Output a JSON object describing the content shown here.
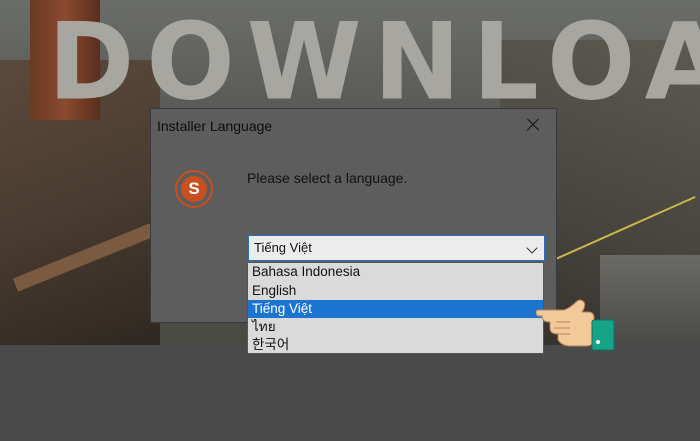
{
  "background": {
    "banner_text": "DOWNLOAD"
  },
  "dialog": {
    "title": "Installer Language",
    "prompt": "Please select a language.",
    "icon_letter": "S",
    "select": {
      "value": "Tiếng Việt"
    },
    "options": [
      {
        "label": "Bahasa Indonesia",
        "selected": false
      },
      {
        "label": "English",
        "selected": false
      },
      {
        "label": "Tiếng Việt",
        "selected": true
      },
      {
        "label": "ไทย",
        "selected": false
      },
      {
        "label": "한국어",
        "selected": false
      }
    ]
  },
  "colors": {
    "accent": "#1b74d0",
    "icon": "#c8501e"
  }
}
